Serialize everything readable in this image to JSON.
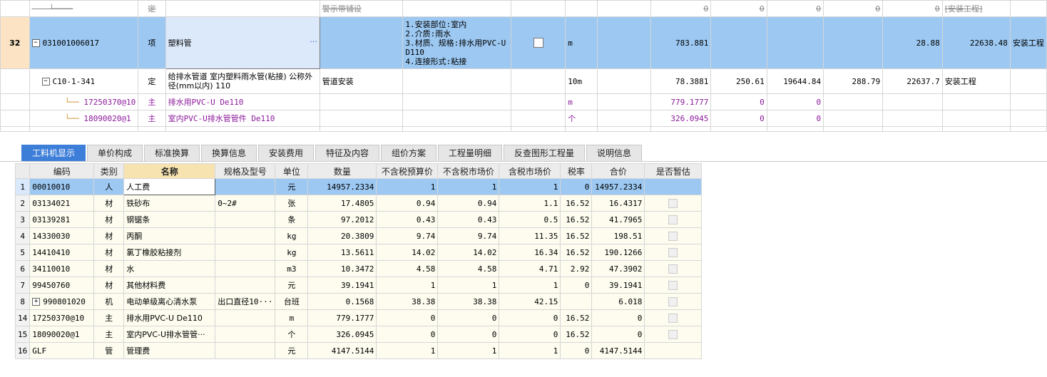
{
  "top_grid": {
    "struck_row": {
      "type": "定",
      "name": "警示带铺设",
      "prices": [
        "0",
        "0",
        "0",
        "0",
        "0"
      ],
      "dept": "[安装工程]"
    },
    "selected_row": {
      "index": "32",
      "code": "031001006017",
      "type": "项",
      "name": "塑料管",
      "more": "···",
      "features": [
        "1.安装部位:室内",
        "2.介质:雨水",
        "3.材质、规格:排水用PVC-U",
        "D110",
        "4.连接形式:粘接"
      ],
      "unit": "m",
      "quantity": "783.881",
      "unit_price": "28.88",
      "total": "22638.48",
      "dept": "安装工程"
    },
    "quota_row": {
      "code": "C10-1-341",
      "type": "定",
      "name": "给排水管道 室内塑料雨水管(粘接) 公称外径(mm以内) 110",
      "content": "管道安装",
      "unit": "10m",
      "quantity": "78.3881",
      "v1": "250.61",
      "v2": "19644.84",
      "unit_price": "288.79",
      "total": "22637.7",
      "dept": "安装工程"
    },
    "main_rows": [
      {
        "code": "17250370@10",
        "type": "主",
        "name": "排水用PVC-U De110",
        "unit": "m",
        "quantity": "779.1777",
        "v1": "0",
        "v2": "0"
      },
      {
        "code": "18090020@1",
        "type": "主",
        "name": "室内PVC-U排水管管件 De110",
        "unit": "个",
        "quantity": "326.0945",
        "v1": "0",
        "v2": "0"
      }
    ]
  },
  "tabs": [
    "工料机显示",
    "单价构成",
    "标准换算",
    "换算信息",
    "安装费用",
    "特征及内容",
    "组价方案",
    "工程量明细",
    "反查图形工程量",
    "说明信息"
  ],
  "active_tab": "工料机显示",
  "bottom_grid": {
    "headers": [
      "编码",
      "类别",
      "名称",
      "规格及型号",
      "单位",
      "数量",
      "不含税预算价",
      "不含税市场价",
      "含税市场价",
      "税率",
      "合价",
      "是否暂估"
    ],
    "rows": [
      {
        "n": "1",
        "code": "00010010",
        "type": "人",
        "name": "人工费",
        "spec": "",
        "unit": "元",
        "qty": "14957.2334",
        "p1": "1",
        "p2": "1",
        "p3": "1",
        "tax": "0",
        "total": "14957.2334",
        "chk": false
      },
      {
        "n": "2",
        "code": "03134021",
        "type": "材",
        "name": "铁砂布",
        "spec": "0~2#",
        "unit": "张",
        "qty": "17.4805",
        "p1": "0.94",
        "p2": "0.94",
        "p3": "1.1",
        "tax": "16.52",
        "total": "16.4317",
        "chk": true
      },
      {
        "n": "3",
        "code": "03139281",
        "type": "材",
        "name": "钢锯条",
        "spec": "",
        "unit": "条",
        "qty": "97.2012",
        "p1": "0.43",
        "p2": "0.43",
        "p3": "0.5",
        "tax": "16.52",
        "total": "41.7965",
        "chk": true
      },
      {
        "n": "4",
        "code": "14330030",
        "type": "材",
        "name": "丙酮",
        "spec": "",
        "unit": "kg",
        "qty": "20.3809",
        "p1": "9.74",
        "p2": "9.74",
        "p3": "11.35",
        "tax": "16.52",
        "total": "198.51",
        "chk": true
      },
      {
        "n": "5",
        "code": "14410410",
        "type": "材",
        "name": "氯丁橡胶粘接剂",
        "spec": "",
        "unit": "kg",
        "qty": "13.5611",
        "p1": "14.02",
        "p2": "14.02",
        "p3": "16.34",
        "tax": "16.52",
        "total": "190.1266",
        "chk": true
      },
      {
        "n": "6",
        "code": "34110010",
        "type": "材",
        "name": "水",
        "spec": "",
        "unit": "m3",
        "qty": "10.3472",
        "p1": "4.58",
        "p2": "4.58",
        "p3": "4.71",
        "tax": "2.92",
        "total": "47.3902",
        "chk": true
      },
      {
        "n": "7",
        "code": "99450760",
        "type": "材",
        "name": "其他材料费",
        "spec": "",
        "unit": "元",
        "qty": "39.1941",
        "p1": "1",
        "p2": "1",
        "p3": "1",
        "tax": "0",
        "total": "39.1941",
        "chk": true
      },
      {
        "n": "8",
        "code": "990801020",
        "type": "机",
        "name": "电动单级离心清水泵",
        "spec": "出口直径10···",
        "unit": "台班",
        "qty": "0.1568",
        "p1": "38.38",
        "p2": "38.38",
        "p3": "42.15",
        "tax": "",
        "total": "6.018",
        "chk": true,
        "expand": true
      },
      {
        "n": "14",
        "code": "17250370@10",
        "type": "主",
        "name": "排水用PVC-U De110",
        "spec": "",
        "unit": "m",
        "qty": "779.1777",
        "p1": "0",
        "p2": "0",
        "p3": "0",
        "tax": "16.52",
        "total": "0",
        "chk": true
      },
      {
        "n": "15",
        "code": "18090020@1",
        "type": "主",
        "name": "室内PVC-U排水管管···",
        "spec": "",
        "unit": "个",
        "qty": "326.0945",
        "p1": "0",
        "p2": "0",
        "p3": "0",
        "tax": "16.52",
        "total": "0",
        "chk": true
      },
      {
        "n": "16",
        "code": "GLF",
        "type": "管",
        "name": "管理费",
        "spec": "",
        "unit": "元",
        "qty": "4147.5144",
        "p1": "1",
        "p2": "1",
        "p3": "1",
        "tax": "0",
        "total": "4147.5144",
        "chk": false
      }
    ]
  }
}
